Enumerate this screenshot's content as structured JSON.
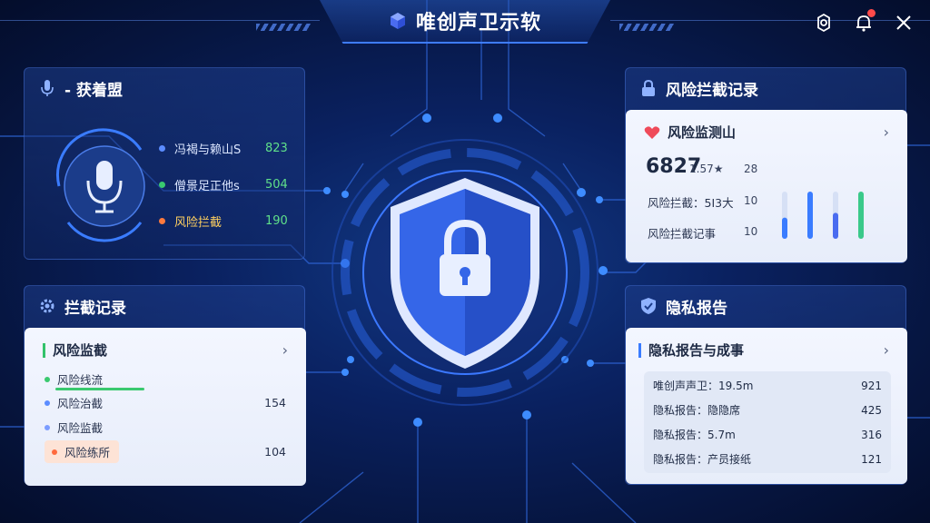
{
  "app": {
    "title": "唯创声卫示软"
  },
  "top_actions": {
    "settings_icon": "gear-icon",
    "notification_icon": "bell-icon",
    "close_icon": "close-icon"
  },
  "voice_panel": {
    "title": "- 获着盟",
    "stats": [
      {
        "label": "冯褐与赖山S",
        "value": "823",
        "dot_color": "#5b8cff"
      },
      {
        "label": "僧景足正他s",
        "value": "504",
        "dot_color": "#3ac96f"
      },
      {
        "label": "风险拦截",
        "value": "190",
        "dot_color": "#ff7a3d"
      }
    ]
  },
  "records_panel": {
    "title": "拦截记录",
    "card_title": "风险监截",
    "rows": [
      {
        "label": "风险线流",
        "value": "",
        "dot_color": "#3ac96f"
      },
      {
        "label": "风险治截",
        "value": "154",
        "dot_color": "#5b8cff"
      },
      {
        "label": "风险监截",
        "value": "",
        "dot_color": "#7b9cff"
      },
      {
        "label": "风险练所",
        "value": "104",
        "dot_color": "#ff6a3d"
      }
    ]
  },
  "risk_panel": {
    "title": "风险拦截记录",
    "card_title": "风险监测山",
    "big_value": "6827",
    "big_sub": "1.57★",
    "big_num": "28",
    "lines": [
      {
        "label": "风险拦截：5I3大",
        "value": "10"
      },
      {
        "label": "风险拦截记事",
        "value": "10"
      }
    ],
    "bars": [
      {
        "fill": 0.45,
        "color": "#3a7cff"
      },
      {
        "fill": 1.0,
        "color": "#3a7cff"
      },
      {
        "fill": 0.55,
        "color": "#4a6cf0"
      },
      {
        "fill": 1.0,
        "color": "#3ac98a"
      }
    ]
  },
  "privacy_panel": {
    "title": "隐私报告",
    "card_title": "隐私报告与成事",
    "rows": [
      {
        "label": "唯创声声卫：19.5m",
        "value": "921"
      },
      {
        "label": "隐私报告：隐隐席",
        "value": "425"
      },
      {
        "label": "隐私报告：5.7m",
        "value": "316"
      },
      {
        "label": "隐私报告：产员接纸",
        "value": "121"
      }
    ]
  }
}
